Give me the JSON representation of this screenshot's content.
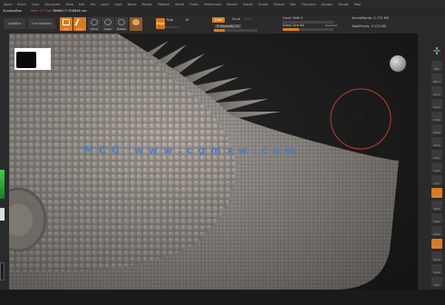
{
  "menu": [
    "Alpha",
    "Brush",
    "Color",
    "Document",
    "Draw",
    "Edit",
    "File",
    "Layer",
    "Light",
    "Macro",
    "Marker",
    "Material",
    "Movie",
    "Picker",
    "Preferences",
    "Render",
    "Stencil",
    "Stroke",
    "Texture",
    "Tool",
    "Transform",
    "Zplugin",
    "Zscript",
    "Help"
  ],
  "info": {
    "mode": "ShadowBox",
    "status": "Mem 27 Free 3.9GB",
    "time": "Timer 27.398848 sec"
  },
  "toolbar": {
    "lightbox": "LightBox",
    "live_boolean": "Live Boolean",
    "tools": [
      {
        "label": "Edit",
        "active": true
      },
      {
        "label": "Draw",
        "active": true
      },
      {
        "label": "Move",
        "active": false
      },
      {
        "label": "Scale",
        "active": false
      },
      {
        "label": "Rotate",
        "active": false
      }
    ],
    "mrgb": "Mrgb",
    "rgb": "Rgb",
    "m": "M",
    "zadd": "Zadd",
    "zsub": "Zsub",
    "zcut": "Zcut",
    "rgb_intensity": "Rgb Intensity",
    "z_intensity": "Z Intensity 25",
    "z_intensity_level": 0.25,
    "focal_shift": "Focal Shift 0",
    "draw_size": "Draw Size 64",
    "dynamic": "Dynamic",
    "active_points": "ActivePoints: 2.772 Mil",
    "total_points": "TotalPoints: 3.123 Mil"
  },
  "viewport": {
    "watermark": "MCG www.cgmxw.com"
  },
  "rightshelf": [
    "BPR",
    "SPix 3",
    "Scroll",
    "Zoom",
    "Actual",
    "AAHalf",
    "Persp",
    "Floor",
    "Local",
    "L.Sym",
    "Frame",
    "Move",
    "Scale",
    "Rotate",
    "Line Fill",
    "Transp",
    "Ghost",
    "Solo",
    "Xpose"
  ],
  "colors": {
    "accent": "#d87a1e",
    "watermark": "#3f7cc9",
    "cursor": "#c0392b"
  }
}
